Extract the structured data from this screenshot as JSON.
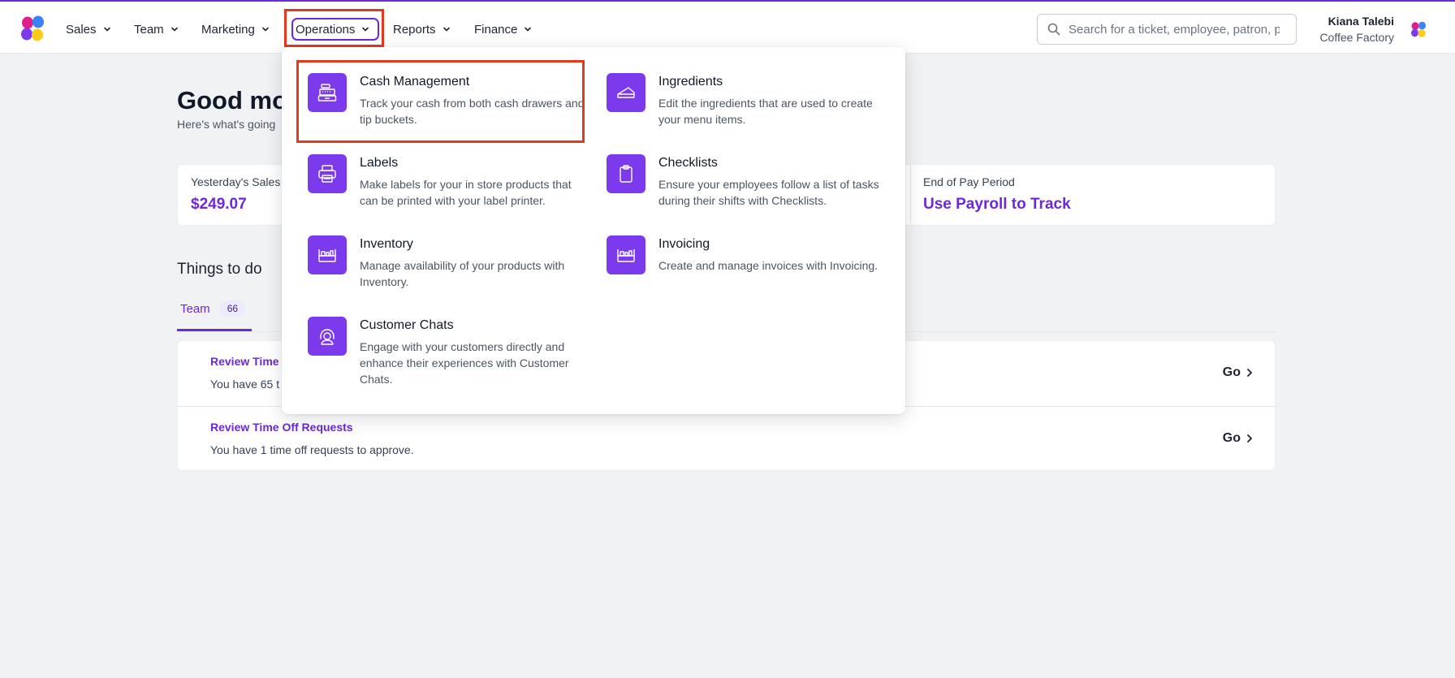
{
  "nav": {
    "items": [
      {
        "label": "Sales"
      },
      {
        "label": "Team"
      },
      {
        "label": "Marketing"
      },
      {
        "label": "Operations"
      },
      {
        "label": "Reports"
      },
      {
        "label": "Finance"
      }
    ],
    "search_placeholder": "Search for a ticket, employee, patron, p",
    "user_name": "Kiana Talebi",
    "user_org": "Coffee Factory"
  },
  "dashboard": {
    "greeting": "Good mor",
    "subgreeting": "Here's what's going",
    "stats": {
      "yesterday_label": "Yesterday's Sales",
      "yesterday_value": "$249.07",
      "pay_label": "End of Pay Period",
      "pay_value": "Use Payroll to Track"
    },
    "todo_title": "Things to do",
    "tab_label": "Team",
    "tab_count": "66",
    "tasks": [
      {
        "title": "Review Time (",
        "desc": "You have 65 t",
        "action": "Go"
      },
      {
        "title": "Review Time Off Requests",
        "desc": "You have 1 time off requests to approve.",
        "action": "Go"
      }
    ]
  },
  "operations_menu": [
    {
      "icon": "cash-register-icon",
      "title": "Cash Management",
      "desc": "Track your cash from both cash drawers and tip buckets."
    },
    {
      "icon": "ingredients-icon",
      "title": "Ingredients",
      "desc": "Edit the ingredients that are used to create your menu items."
    },
    {
      "icon": "printer-icon",
      "title": "Labels",
      "desc": "Make labels for your in store products that can be printed with your label printer."
    },
    {
      "icon": "clipboard-icon",
      "title": "Checklists",
      "desc": "Ensure your employees follow a list of tasks during their shifts with Checklists."
    },
    {
      "icon": "inventory-icon",
      "title": "Inventory",
      "desc": "Manage availability of your products with Inventory."
    },
    {
      "icon": "invoicing-icon",
      "title": "Invoicing",
      "desc": "Create and manage invoices with Invoicing."
    },
    {
      "icon": "headset-icon",
      "title": "Customer Chats",
      "desc": "Engage with your customers directly and enhance their experiences with Customer Chats."
    }
  ],
  "colors": {
    "brand": "#6d28d9",
    "icon_tile": "#7c3aed",
    "highlight": "#e2391f"
  }
}
